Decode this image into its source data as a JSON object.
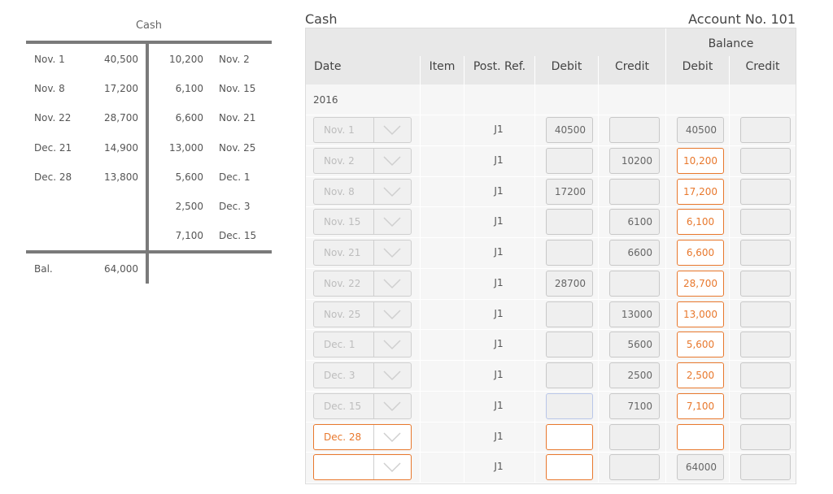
{
  "t_account": {
    "title": "Cash",
    "debits": [
      {
        "date": "Nov. 1",
        "amount": "40,500"
      },
      {
        "date": "Nov. 8",
        "amount": "17,200"
      },
      {
        "date": "Nov. 22",
        "amount": "28,700"
      },
      {
        "date": "Dec. 21",
        "amount": "14,900"
      },
      {
        "date": "Dec. 28",
        "amount": "13,800"
      }
    ],
    "credits": [
      {
        "date": "Nov. 2",
        "amount": "10,200"
      },
      {
        "date": "Nov. 15",
        "amount": "6,100"
      },
      {
        "date": "Nov. 21",
        "amount": "6,600"
      },
      {
        "date": "Nov. 25",
        "amount": "13,000"
      },
      {
        "date": "Dec. 1",
        "amount": "5,600"
      },
      {
        "date": "Dec. 3",
        "amount": "2,500"
      },
      {
        "date": "Dec. 15",
        "amount": "7,100"
      }
    ],
    "balance_label": "Bal.",
    "balance_amount": "64,000"
  },
  "ledger": {
    "title": "Cash",
    "account_no": "Account No. 101",
    "headers": {
      "date": "Date",
      "item": "Item",
      "post_ref": "Post. Ref.",
      "debit": "Debit",
      "credit": "Credit",
      "balance": "Balance",
      "balance_debit": "Debit",
      "balance_credit": "Credit"
    },
    "year": "2016",
    "rows": [
      {
        "date": "Nov. 1",
        "post_ref": "J1",
        "debit": "40500",
        "credit": "",
        "bal_debit": "40500",
        "bal_debit_state": "plain"
      },
      {
        "date": "Nov. 2",
        "post_ref": "J1",
        "debit": "",
        "credit": "10200",
        "bal_debit": "10,200",
        "bal_debit_state": "highlight"
      },
      {
        "date": "Nov. 8",
        "post_ref": "J1",
        "debit": "17200",
        "credit": "",
        "bal_debit": "17,200",
        "bal_debit_state": "highlight"
      },
      {
        "date": "Nov. 15",
        "post_ref": "J1",
        "debit": "",
        "credit": "6100",
        "bal_debit": "6,100",
        "bal_debit_state": "highlight"
      },
      {
        "date": "Nov. 21",
        "post_ref": "J1",
        "debit": "",
        "credit": "6600",
        "bal_debit": "6,600",
        "bal_debit_state": "highlight"
      },
      {
        "date": "Nov. 22",
        "post_ref": "J1",
        "debit": "28700",
        "credit": "",
        "bal_debit": "28,700",
        "bal_debit_state": "highlight"
      },
      {
        "date": "Nov. 25",
        "post_ref": "J1",
        "debit": "",
        "credit": "13000",
        "bal_debit": "13,000",
        "bal_debit_state": "highlight"
      },
      {
        "date": "Dec. 1",
        "post_ref": "J1",
        "debit": "",
        "credit": "5600",
        "bal_debit": "5,600",
        "bal_debit_state": "highlight"
      },
      {
        "date": "Dec. 3",
        "post_ref": "J1",
        "debit": "",
        "credit": "2500",
        "bal_debit": "2,500",
        "bal_debit_state": "highlight"
      },
      {
        "date": "Dec. 15",
        "post_ref": "J1",
        "debit": "",
        "credit": "7100",
        "bal_debit": "7,100",
        "bal_debit_state": "highlight"
      },
      {
        "date": "Dec. 28",
        "date_state": "highlight",
        "post_ref": "J1",
        "debit": "",
        "debit_state": "highlight",
        "credit": "",
        "bal_debit": "",
        "bal_debit_state": "highlight"
      },
      {
        "date": "",
        "date_state": "highlight",
        "post_ref": "J1",
        "debit": "",
        "debit_state": "highlight",
        "credit": "",
        "bal_debit": "64000",
        "bal_debit_state": "plain"
      }
    ]
  },
  "colors": {
    "accent": "#e8782d",
    "header_bg": "#e8e8e8",
    "rule": "#7a7a7a"
  }
}
